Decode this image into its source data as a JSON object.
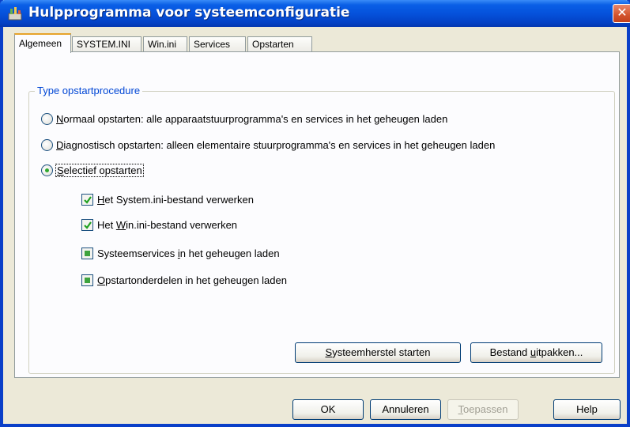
{
  "window": {
    "title": "Hulpprogramma voor systeemconfiguratie",
    "close_glyph": "✕"
  },
  "tabs": [
    {
      "label": "Algemeen",
      "active": true
    },
    {
      "label": "SYSTEM.INI",
      "active": false
    },
    {
      "label": "Win.ini",
      "active": false
    },
    {
      "label": "Services",
      "active": false
    },
    {
      "label": "Opstarten",
      "active": false
    }
  ],
  "startup_group": {
    "title": "Type opstartprocedure",
    "options": [
      {
        "accel": "N",
        "rest": "ormaal opstarten: alle apparaatstuurprogramma's en services in het geheugen laden",
        "selected": false
      },
      {
        "accel": "D",
        "rest": "iagnostisch opstarten: alleen elementaire stuurprogramma's en services in het geheugen laden",
        "selected": false
      },
      {
        "accel": "S",
        "rest": "electief opstarten",
        "selected": true
      }
    ],
    "checkboxes": [
      {
        "pre": "",
        "accel": "H",
        "post": "et System.ini-bestand verwerken",
        "state": "checked"
      },
      {
        "pre": "Het ",
        "accel": "W",
        "post": "in.ini-bestand verwerken",
        "state": "checked"
      },
      {
        "pre": "Systeemservices ",
        "accel": "i",
        "post": "n het geheugen laden",
        "state": "indeterminate"
      },
      {
        "pre": "",
        "accel": "O",
        "post": "pstartonderdelen in het geheugen laden",
        "state": "indeterminate"
      }
    ]
  },
  "panel_buttons": {
    "restore": {
      "accel": "S",
      "rest": "ysteemherstel starten"
    },
    "extract": {
      "pre": "Bestand ",
      "accel": "u",
      "post": "itpakken..."
    }
  },
  "dialog_buttons": {
    "ok": "OK",
    "cancel": "Annuleren",
    "apply": {
      "accel": "T",
      "rest": "oepassen"
    },
    "help": "Help"
  },
  "colors": {
    "titlebar": "#0552dc",
    "group_title": "#0046d5",
    "checkbox_fill": "#3ea33e"
  }
}
